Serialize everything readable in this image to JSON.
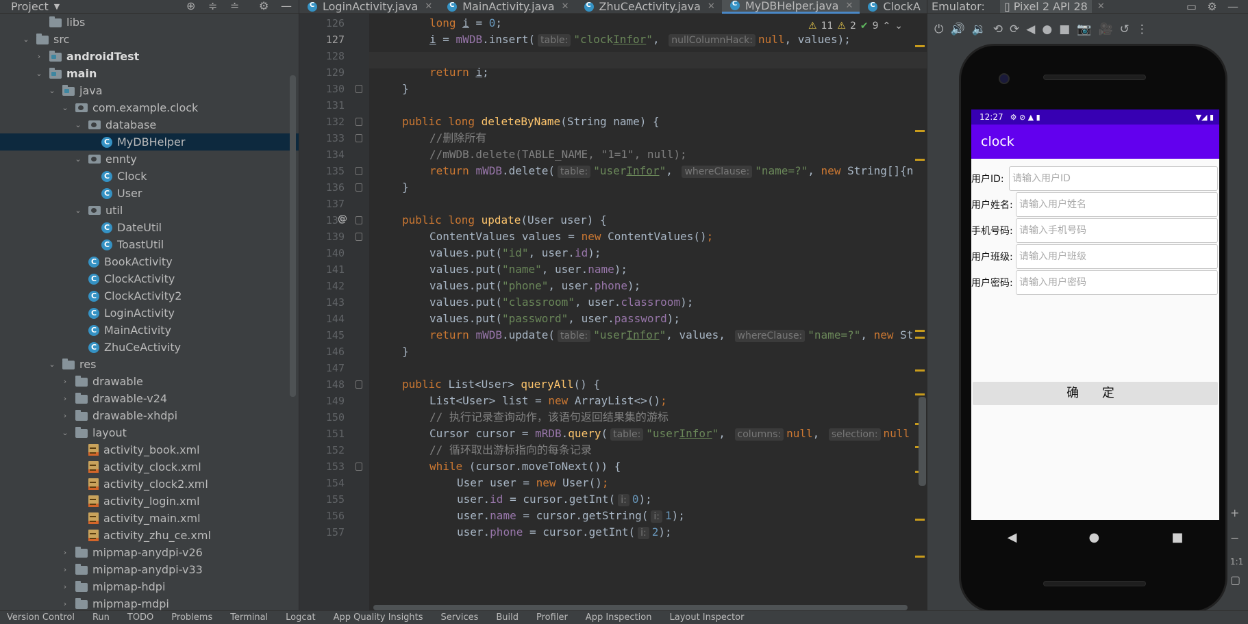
{
  "project": {
    "title": "Project",
    "tree": [
      {
        "label": "libs",
        "depth": 2,
        "icon": "folder",
        "arrow": "none"
      },
      {
        "label": "src",
        "depth": 1,
        "icon": "folder",
        "arrow": "down"
      },
      {
        "label": "androidTest",
        "depth": 2,
        "icon": "folder-mod",
        "arrow": "right",
        "bold": true
      },
      {
        "label": "main",
        "depth": 2,
        "icon": "folder-mod",
        "arrow": "down",
        "bold": true
      },
      {
        "label": "java",
        "depth": 3,
        "icon": "folder-src",
        "arrow": "down"
      },
      {
        "label": "com.example.clock",
        "depth": 4,
        "icon": "pkg",
        "arrow": "down"
      },
      {
        "label": "database",
        "depth": 5,
        "icon": "pkg",
        "arrow": "down"
      },
      {
        "label": "MyDBHelper",
        "depth": 6,
        "icon": "class",
        "arrow": "none",
        "selected": true
      },
      {
        "label": "ennty",
        "depth": 5,
        "icon": "pkg",
        "arrow": "down"
      },
      {
        "label": "Clock",
        "depth": 6,
        "icon": "class",
        "arrow": "none"
      },
      {
        "label": "User",
        "depth": 6,
        "icon": "class",
        "arrow": "none"
      },
      {
        "label": "util",
        "depth": 5,
        "icon": "pkg",
        "arrow": "down"
      },
      {
        "label": "DateUtil",
        "depth": 6,
        "icon": "class",
        "arrow": "none"
      },
      {
        "label": "ToastUtil",
        "depth": 6,
        "icon": "class",
        "arrow": "none"
      },
      {
        "label": "BookActivity",
        "depth": 5,
        "icon": "class",
        "arrow": "none"
      },
      {
        "label": "ClockActivity",
        "depth": 5,
        "icon": "class",
        "arrow": "none"
      },
      {
        "label": "ClockActivity2",
        "depth": 5,
        "icon": "class",
        "arrow": "none"
      },
      {
        "label": "LoginActivity",
        "depth": 5,
        "icon": "class",
        "arrow": "none"
      },
      {
        "label": "MainActivity",
        "depth": 5,
        "icon": "class",
        "arrow": "none"
      },
      {
        "label": "ZhuCeActivity",
        "depth": 5,
        "icon": "class",
        "arrow": "none"
      },
      {
        "label": "res",
        "depth": 3,
        "icon": "folder",
        "arrow": "down"
      },
      {
        "label": "drawable",
        "depth": 4,
        "icon": "folder",
        "arrow": "right"
      },
      {
        "label": "drawable-v24",
        "depth": 4,
        "icon": "folder",
        "arrow": "right"
      },
      {
        "label": "drawable-xhdpi",
        "depth": 4,
        "icon": "folder",
        "arrow": "right"
      },
      {
        "label": "layout",
        "depth": 4,
        "icon": "folder",
        "arrow": "down"
      },
      {
        "label": "activity_book.xml",
        "depth": 5,
        "icon": "xml",
        "arrow": "none"
      },
      {
        "label": "activity_clock.xml",
        "depth": 5,
        "icon": "xml",
        "arrow": "none"
      },
      {
        "label": "activity_clock2.xml",
        "depth": 5,
        "icon": "xml",
        "arrow": "none"
      },
      {
        "label": "activity_login.xml",
        "depth": 5,
        "icon": "xml",
        "arrow": "none"
      },
      {
        "label": "activity_main.xml",
        "depth": 5,
        "icon": "xml",
        "arrow": "none"
      },
      {
        "label": "activity_zhu_ce.xml",
        "depth": 5,
        "icon": "xml",
        "arrow": "none"
      },
      {
        "label": "mipmap-anydpi-v26",
        "depth": 4,
        "icon": "folder",
        "arrow": "right"
      },
      {
        "label": "mipmap-anydpi-v33",
        "depth": 4,
        "icon": "folder",
        "arrow": "right"
      },
      {
        "label": "mipmap-hdpi",
        "depth": 4,
        "icon": "folder",
        "arrow": "right"
      },
      {
        "label": "mipmap-mdpi",
        "depth": 4,
        "icon": "folder",
        "arrow": "right"
      }
    ]
  },
  "editor": {
    "tabs": [
      {
        "label": "LoginActivity.java",
        "active": false
      },
      {
        "label": "MainActivity.java",
        "active": false
      },
      {
        "label": "ZhuCeActivity.java",
        "active": false
      },
      {
        "label": "MyDBHelper.java",
        "active": true
      },
      {
        "label": "ClockA",
        "active": false
      }
    ],
    "inspections": {
      "warnings": "11",
      "weak_warnings": "2",
      "ok": "9"
    },
    "current_line": 127,
    "lines": [
      {
        "n": "126",
        "indent": 2,
        "tokens": [
          [
            "kw",
            "long "
          ],
          [
            "u",
            "i"
          ],
          [
            "",
            " = "
          ],
          [
            "num",
            "0"
          ],
          [
            "",
            ";"
          ]
        ]
      },
      {
        "n": "127",
        "indent": 2,
        "tokens": [
          [
            "u",
            "i"
          ],
          [
            "",
            " = "
          ],
          [
            "fld",
            "mWDB"
          ],
          [
            "",
            ".insert("
          ],
          [
            "hint",
            "table:"
          ],
          [
            "str",
            "\"clock"
          ],
          [
            "stru",
            "Infor"
          ],
          [
            "str",
            "\""
          ],
          [
            "",
            ", "
          ],
          [
            "hint",
            "nullColumnHack:"
          ],
          [
            "kw",
            "null"
          ],
          [
            "",
            ", values);"
          ]
        ]
      },
      {
        "n": "128",
        "indent": 0,
        "tokens": []
      },
      {
        "n": "129",
        "indent": 2,
        "tokens": [
          [
            "kw",
            "return "
          ],
          [
            "u",
            "i"
          ],
          [
            "",
            ";"
          ]
        ]
      },
      {
        "n": "130",
        "indent": 1,
        "tokens": [
          [
            "",
            "}"
          ]
        ]
      },
      {
        "n": "131",
        "indent": 0,
        "tokens": []
      },
      {
        "n": "132",
        "indent": 1,
        "tokens": [
          [
            "kw",
            "public long "
          ],
          [
            "fn",
            "deleteByName"
          ],
          [
            "",
            "(String name) {"
          ]
        ]
      },
      {
        "n": "133",
        "indent": 2,
        "tokens": [
          [
            "cm",
            "//删除所有"
          ]
        ]
      },
      {
        "n": "134",
        "indent": 2,
        "tokens": [
          [
            "cm",
            "//mWDB.delete(TABLE_NAME, \"1=1\", null);"
          ]
        ]
      },
      {
        "n": "135",
        "indent": 2,
        "tokens": [
          [
            "kw",
            "return "
          ],
          [
            "fld",
            "mWDB"
          ],
          [
            "",
            ".delete("
          ],
          [
            "hint",
            "table:"
          ],
          [
            "str",
            "\"user"
          ],
          [
            "stru",
            "Infor"
          ],
          [
            "str",
            "\""
          ],
          [
            "",
            ", "
          ],
          [
            "hint",
            "whereClause:"
          ],
          [
            "str",
            "\"name=?\""
          ],
          [
            "",
            ", "
          ],
          [
            "kw",
            "new "
          ],
          [
            "",
            "String[]{n"
          ]
        ]
      },
      {
        "n": "136",
        "indent": 1,
        "tokens": [
          [
            "",
            "}"
          ]
        ]
      },
      {
        "n": "137",
        "indent": 0,
        "tokens": []
      },
      {
        "n": "138",
        "indent": 1,
        "tokens": [
          [
            "kw",
            "public long "
          ],
          [
            "fn",
            "update"
          ],
          [
            "",
            "(User user) {"
          ]
        ]
      },
      {
        "n": "139",
        "indent": 2,
        "tokens": [
          [
            "",
            "ContentValues values = "
          ],
          [
            "kw",
            "new "
          ],
          [
            "",
            "ContentValues()"
          ],
          [
            "kw",
            ";"
          ]
        ]
      },
      {
        "n": "140",
        "indent": 2,
        "tokens": [
          [
            "",
            "values.put("
          ],
          [
            "str",
            "\"id\""
          ],
          [
            "",
            ", user."
          ],
          [
            "fld",
            "id"
          ],
          [
            "",
            ");"
          ]
        ]
      },
      {
        "n": "141",
        "indent": 2,
        "tokens": [
          [
            "",
            "values.put("
          ],
          [
            "str",
            "\"name\""
          ],
          [
            "",
            ", user."
          ],
          [
            "fld",
            "name"
          ],
          [
            "",
            ");"
          ]
        ]
      },
      {
        "n": "142",
        "indent": 2,
        "tokens": [
          [
            "",
            "values.put("
          ],
          [
            "str",
            "\"phone\""
          ],
          [
            "",
            ", user."
          ],
          [
            "fld",
            "phone"
          ],
          [
            "",
            ");"
          ]
        ]
      },
      {
        "n": "143",
        "indent": 2,
        "tokens": [
          [
            "",
            "values.put("
          ],
          [
            "str",
            "\"classroom\""
          ],
          [
            "",
            ", user."
          ],
          [
            "fld",
            "classroom"
          ],
          [
            "",
            ");"
          ]
        ]
      },
      {
        "n": "144",
        "indent": 2,
        "tokens": [
          [
            "",
            "values.put("
          ],
          [
            "str",
            "\"password\""
          ],
          [
            "",
            ", user."
          ],
          [
            "fld",
            "password"
          ],
          [
            "",
            ");"
          ]
        ]
      },
      {
        "n": "145",
        "indent": 2,
        "tokens": [
          [
            "kw",
            "return "
          ],
          [
            "fld",
            "mWDB"
          ],
          [
            "",
            ".update("
          ],
          [
            "hint",
            "table:"
          ],
          [
            "str",
            "\"user"
          ],
          [
            "stru",
            "Infor"
          ],
          [
            "str",
            "\""
          ],
          [
            "",
            ", values, "
          ],
          [
            "hint",
            "whereClause:"
          ],
          [
            "str",
            "\"name=?\""
          ],
          [
            "",
            ", "
          ],
          [
            "kw",
            "new "
          ],
          [
            "",
            "St"
          ]
        ]
      },
      {
        "n": "146",
        "indent": 1,
        "tokens": [
          [
            "",
            "}"
          ]
        ]
      },
      {
        "n": "147",
        "indent": 0,
        "tokens": []
      },
      {
        "n": "148",
        "indent": 1,
        "tokens": [
          [
            "kw",
            "public "
          ],
          [
            "",
            "List<User> "
          ],
          [
            "fn",
            "queryAll"
          ],
          [
            "",
            "() {"
          ]
        ]
      },
      {
        "n": "149",
        "indent": 2,
        "tokens": [
          [
            "",
            "List<User> list = "
          ],
          [
            "kw",
            "new "
          ],
          [
            "",
            "ArrayList<>()"
          ],
          [
            "kw",
            ";"
          ]
        ]
      },
      {
        "n": "150",
        "indent": 2,
        "tokens": [
          [
            "cm",
            "// 执行记录查询动作，该语句返回结果集的游标"
          ]
        ]
      },
      {
        "n": "151",
        "indent": 2,
        "tokens": [
          [
            "",
            "Cursor cursor = "
          ],
          [
            "fld",
            "mRDB"
          ],
          [
            "",
            "."
          ],
          [
            "fn",
            "query"
          ],
          [
            "",
            "("
          ],
          [
            "hint",
            "table:"
          ],
          [
            "str",
            "\"user"
          ],
          [
            "stru",
            "Infor"
          ],
          [
            "str",
            "\""
          ],
          [
            "",
            ", "
          ],
          [
            "hint",
            "columns:"
          ],
          [
            "kw",
            "null"
          ],
          [
            "",
            ", "
          ],
          [
            "hint",
            "selection:"
          ],
          [
            "kw",
            "null"
          ]
        ]
      },
      {
        "n": "152",
        "indent": 2,
        "tokens": [
          [
            "cm",
            "// 循环取出游标指向的每条记录"
          ]
        ]
      },
      {
        "n": "153",
        "indent": 2,
        "tokens": [
          [
            "kw",
            "while "
          ],
          [
            "",
            "(cursor.moveToNext()) {"
          ]
        ]
      },
      {
        "n": "154",
        "indent": 3,
        "tokens": [
          [
            "",
            "User user = "
          ],
          [
            "kw",
            "new "
          ],
          [
            "",
            "User()"
          ],
          [
            "kw",
            ";"
          ]
        ]
      },
      {
        "n": "155",
        "indent": 3,
        "tokens": [
          [
            "",
            "user."
          ],
          [
            "fld",
            "id"
          ],
          [
            "",
            " = cursor.getInt("
          ],
          [
            "hint",
            "i:"
          ],
          [
            "num",
            "0"
          ],
          [
            "",
            ");"
          ]
        ]
      },
      {
        "n": "156",
        "indent": 3,
        "tokens": [
          [
            "",
            "user."
          ],
          [
            "fld",
            "name"
          ],
          [
            "",
            " = cursor.getString("
          ],
          [
            "hint",
            "i:"
          ],
          [
            "num",
            "1"
          ],
          [
            "",
            ");"
          ]
        ]
      },
      {
        "n": "157",
        "indent": 3,
        "tokens": [
          [
            "",
            "user."
          ],
          [
            "fld",
            "phone"
          ],
          [
            "",
            " = cursor.getInt("
          ],
          [
            "hint",
            "i:"
          ],
          [
            "num",
            "2"
          ],
          [
            "",
            ");"
          ]
        ]
      }
    ]
  },
  "emulator": {
    "label": "Emulator:",
    "device": "Pixel 2 API 28",
    "status_time": "12:27",
    "app_title": "clock",
    "fields": [
      {
        "label": "用户ID:",
        "placeholder": "请输入用户ID"
      },
      {
        "label": "用户姓名:",
        "placeholder": "请输入用户姓名"
      },
      {
        "label": "手机号码:",
        "placeholder": "请输入手机号码"
      },
      {
        "label": "用户班级:",
        "placeholder": "请输入用户班级"
      },
      {
        "label": "用户密码:",
        "placeholder": "请输入用户密码"
      }
    ],
    "confirm": "确 定",
    "zoom": "1:1"
  },
  "bottom_bar": [
    "Version Control",
    "Run",
    "TODO",
    "Problems",
    "Terminal",
    "Logcat",
    "App Quality Insights",
    "Services",
    "Build",
    "Profiler",
    "App Inspection",
    "Layout Inspector"
  ]
}
